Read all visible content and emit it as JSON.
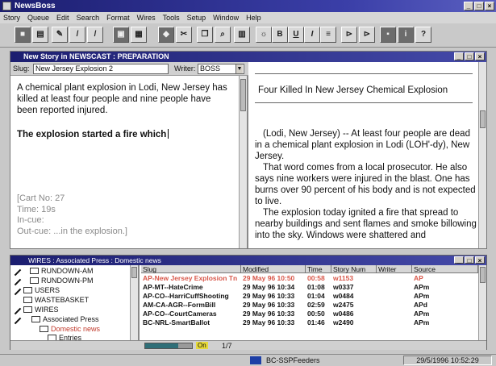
{
  "app": {
    "title": "NewsBoss"
  },
  "menu": [
    "Story",
    "Queue",
    "Edit",
    "Search",
    "Format",
    "Wires",
    "Tools",
    "Setup",
    "Window",
    "Help"
  ],
  "toolbar": {
    "bold": "B",
    "underline": "U",
    "italic": "I",
    "help": "?"
  },
  "story_window": {
    "title": "New Story in NEWSCAST : PREPARATION",
    "slug_label": "Slug:",
    "slug_value": "New Jersey Explosion 2",
    "writer_label": "Writer:",
    "writer_value": "BOSS",
    "body": [
      "A chemical plant explosion in Lodi, New Jersey has killed at least four people and nine people have been reported injured.",
      "The explosion started a fire which"
    ],
    "cue": {
      "cart": "[Cart No: 27",
      "time": "Time: 19s",
      "in_cue": "In-cue:",
      "out_cue": "Out-cue: ...in the explosion.]"
    }
  },
  "wire_story": {
    "headline": "Four Killed In New Jersey Chemical Explosion",
    "paragraphs": [
      "(Lodi, New Jersey) -- At least four people are dead in a chemical plant explosion in Lodi (LOH'-dy), New Jersey.",
      "That word comes from a local prosecutor. He also says nine workers were injured in the blast. One has burns over 90 percent of his body and is not expected to live.",
      "The explosion today ignited a fire that spread to nearby buildings and sent flames and smoke billowing into the sky. Windows were shattered and"
    ]
  },
  "rundown_window": {
    "title": "WIRES : Associated Press : Domestic news",
    "tree": [
      {
        "label": "RUNDOWN-AM",
        "indent": 1
      },
      {
        "label": "RUNDOWN-PM",
        "indent": 1
      },
      {
        "label": "USERS",
        "indent": 0
      },
      {
        "label": "WASTEBASKET",
        "indent": 0
      },
      {
        "label": "WIRES",
        "indent": 0
      },
      {
        "label": "Associated Press",
        "indent": 1
      },
      {
        "label": "Domestic news",
        "indent": 2
      },
      {
        "label": "Entries",
        "indent": 3
      }
    ],
    "columns": [
      "Slug",
      "Modified",
      "Time",
      "Story Num",
      "Writer",
      "Source"
    ],
    "rows": [
      {
        "slug": "AP-New Jersey Explosion Tn",
        "modified": "29 May 96 10:50",
        "time": "00:58",
        "num": "w1153",
        "source": "AP",
        "highlight": true
      },
      {
        "slug": "AP-MT--HateCrime",
        "modified": "29 May 96 10:34",
        "time": "01:08",
        "num": "w0337",
        "source": "APm"
      },
      {
        "slug": "AP-CO--HarriCuffShooting",
        "modified": "29 May 96 10:33",
        "time": "01:04",
        "num": "w0484",
        "source": "APm"
      },
      {
        "slug": "AM-CA-AGR--FormBill",
        "modified": "29 May 96 10:33",
        "time": "02:59",
        "num": "w2475",
        "source": "APd"
      },
      {
        "slug": "AP-CO--CourtCameras",
        "modified": "29 May 96 10:33",
        "time": "00:50",
        "num": "w0486",
        "source": "APm"
      },
      {
        "slug": "BC-NRL-SmartBallot",
        "modified": "29 May 96 10:33",
        "time": "01:46",
        "num": "w2490",
        "source": "APm"
      }
    ],
    "pager": "1/7",
    "progress_label": "On",
    "progress": 0.7
  },
  "status": {
    "feed": "BC-SSPFeeders",
    "datetime": "29/5/1996 10:52:29"
  },
  "colors": {
    "title_bar": "#1c1e70",
    "highlight_row": "#d8574a",
    "progress_fill": "#2f6f78"
  }
}
